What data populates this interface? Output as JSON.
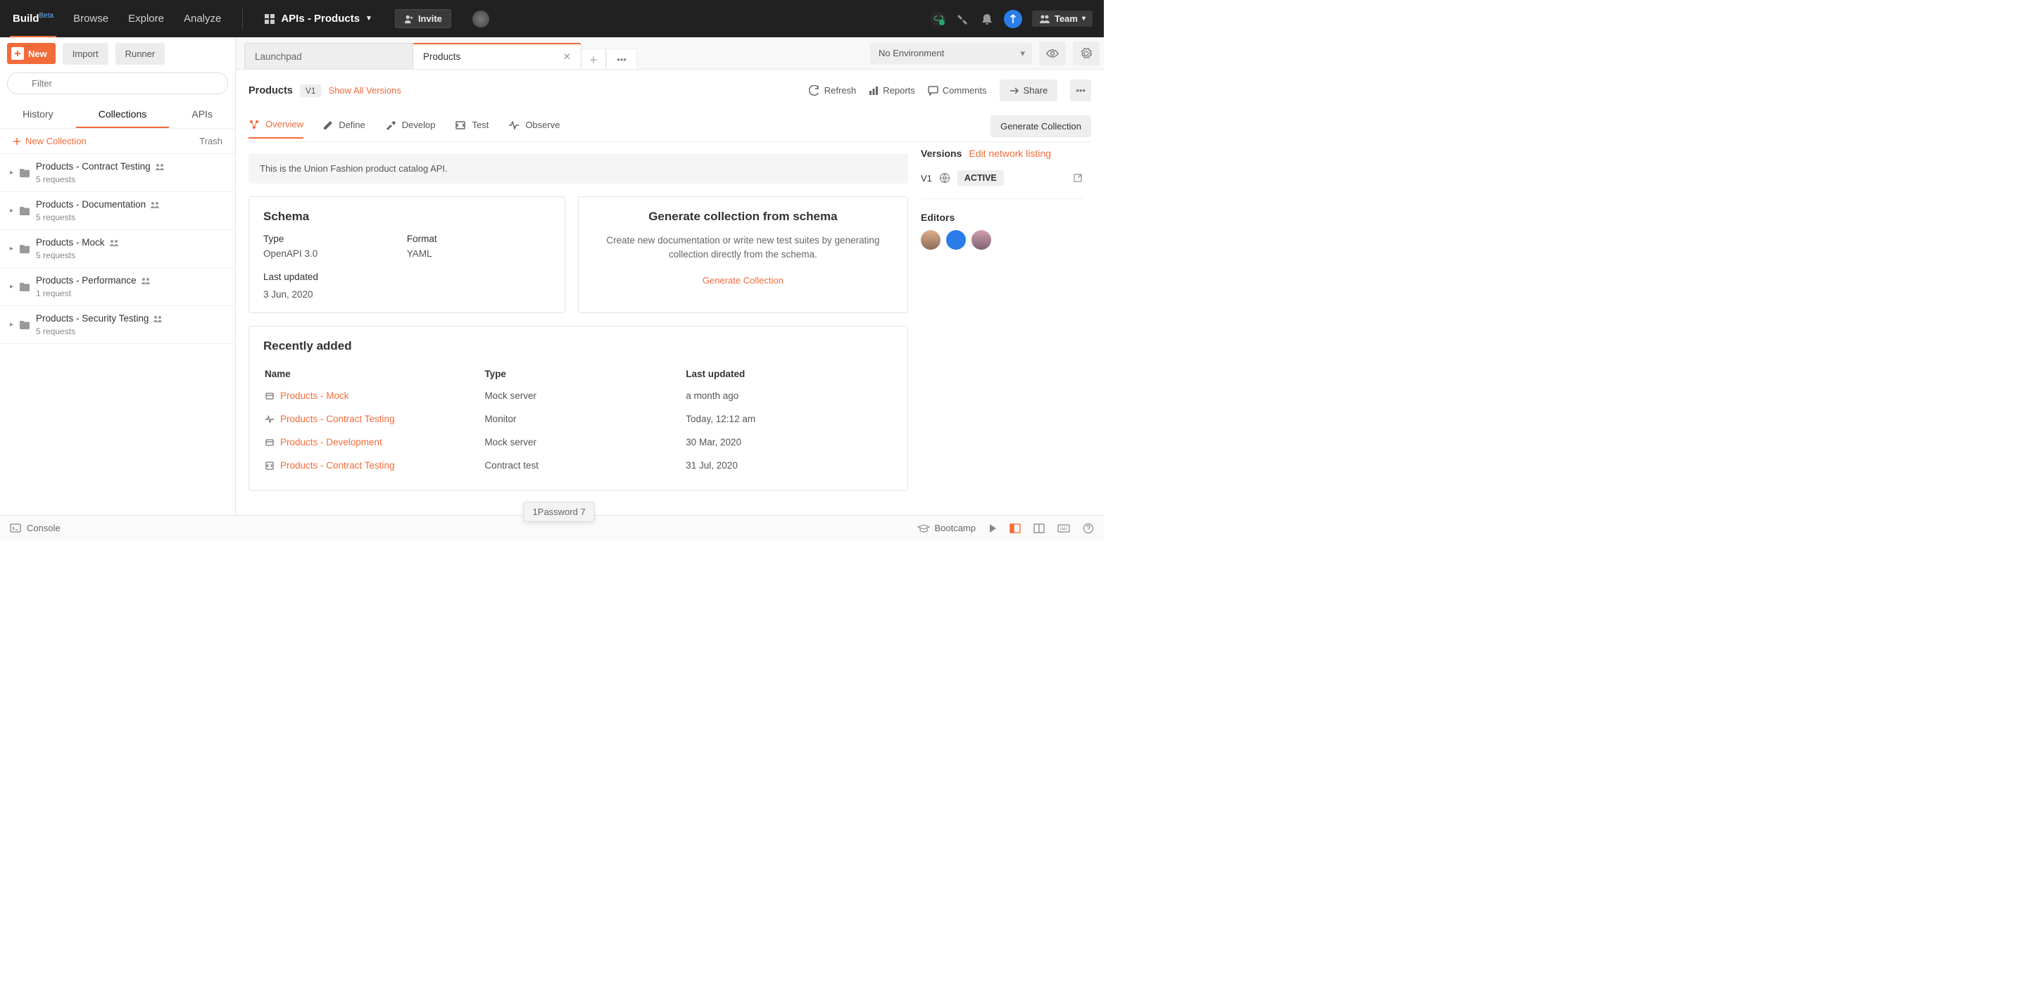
{
  "topbar": {
    "build": "Build",
    "beta": "Beta",
    "browse": "Browse",
    "explore": "Explore",
    "analyze": "Analyze",
    "workspace": "APIs - Products",
    "invite": "Invite",
    "team": "Team"
  },
  "toolbar": {
    "new": "New",
    "import": "Import",
    "runner": "Runner"
  },
  "filter": {
    "placeholder": "Filter"
  },
  "sidebarTabs": {
    "history": "History",
    "collections": "Collections",
    "apis": "APIs"
  },
  "sidebarActions": {
    "newCollection": "New Collection",
    "trash": "Trash"
  },
  "collections": [
    {
      "name": "Products - Contract Testing",
      "sub": "5 requests"
    },
    {
      "name": "Products - Documentation",
      "sub": "5 requests"
    },
    {
      "name": "Products - Mock",
      "sub": "5 requests"
    },
    {
      "name": "Products - Performance",
      "sub": "1 request"
    },
    {
      "name": "Products - Security Testing",
      "sub": "5 requests"
    }
  ],
  "tabs": {
    "launchpad": "Launchpad",
    "products": "Products"
  },
  "env": {
    "none": "No Environment"
  },
  "header": {
    "name": "Products",
    "version": "V1",
    "showAll": "Show All Versions",
    "refresh": "Refresh",
    "reports": "Reports",
    "comments": "Comments",
    "share": "Share",
    "generate": "Generate Collection"
  },
  "innerTabs": {
    "overview": "Overview",
    "define": "Define",
    "develop": "Develop",
    "test": "Test",
    "observe": "Observe"
  },
  "description": "This is the Union Fashion product catalog API.",
  "schema": {
    "title": "Schema",
    "typeLabel": "Type",
    "typeValue": "OpenAPI 3.0",
    "formatLabel": "Format",
    "formatValue": "YAML",
    "updatedLabel": "Last updated",
    "updatedValue": "3 Jun, 2020"
  },
  "genCard": {
    "title": "Generate collection from schema",
    "body": "Create new documentation or write new test suites by generating collection directly from the schema.",
    "link": "Generate Collection"
  },
  "recent": {
    "title": "Recently added",
    "cols": {
      "name": "Name",
      "type": "Type",
      "updated": "Last updated"
    },
    "rows": [
      {
        "name": "Products - Mock",
        "type": "Mock server",
        "updated": "a month ago",
        "icon": "server"
      },
      {
        "name": "Products - Contract Testing",
        "type": "Monitor",
        "updated": "Today, 12:12 am",
        "icon": "monitor"
      },
      {
        "name": "Products - Development",
        "type": "Mock server",
        "updated": "30 Mar, 2020",
        "icon": "server"
      },
      {
        "name": "Products - Contract Testing",
        "type": "Contract test",
        "updated": "31 Jul, 2020",
        "icon": "contract"
      }
    ]
  },
  "rail": {
    "versions": "Versions",
    "edit": "Edit network listing",
    "v": "V1",
    "active": "ACTIVE",
    "editors": "Editors"
  },
  "footer": {
    "console": "Console",
    "bootcamp": "Bootcamp"
  },
  "tooltip": "1Password 7"
}
